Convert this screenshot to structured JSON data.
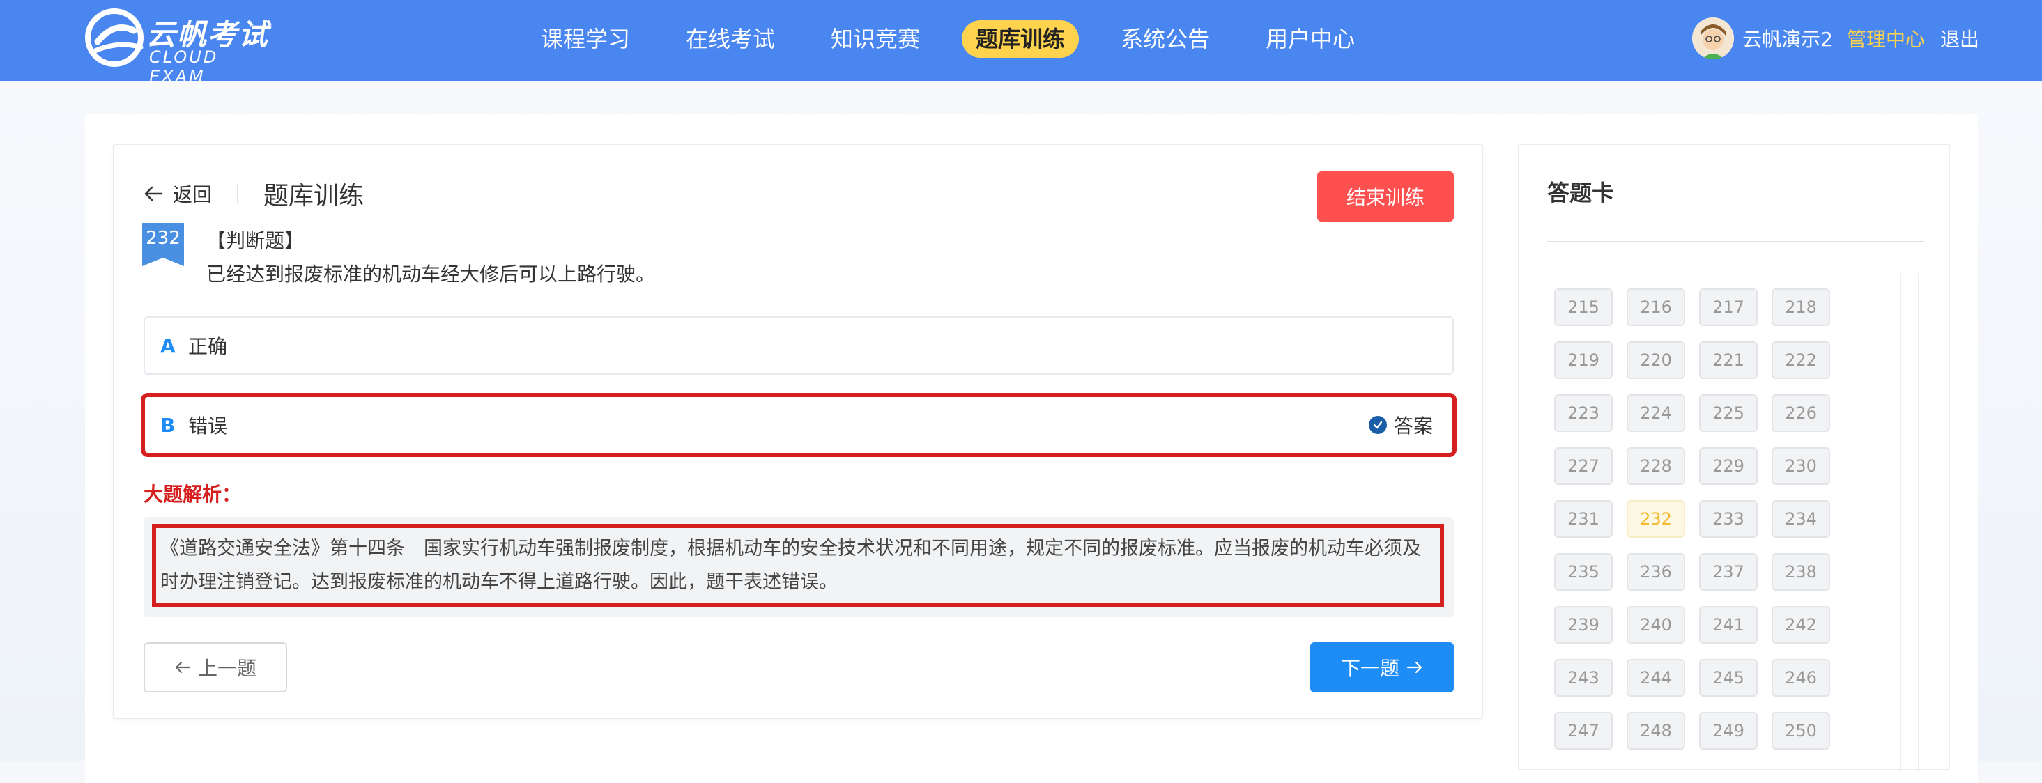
{
  "brand": {
    "name_cn": "云帆考试",
    "name_en": "CLOUD EXAM"
  },
  "nav": {
    "items": [
      {
        "label": "课程学习",
        "active": false
      },
      {
        "label": "在线考试",
        "active": false
      },
      {
        "label": "知识竞赛",
        "active": false
      },
      {
        "label": "题库训练",
        "active": true
      },
      {
        "label": "系统公告",
        "active": false
      },
      {
        "label": "用户中心",
        "active": false
      }
    ]
  },
  "user": {
    "name": "云帆演示2",
    "admin_label": "管理中心",
    "logout_label": "退出"
  },
  "header": {
    "back_label": "返回",
    "title": "题库训练",
    "end_button": "结束训练"
  },
  "question": {
    "number": "232",
    "type": "【判断题】",
    "text": "已经达到报废标准的机动车经大修后可以上路行驶。",
    "options": [
      {
        "letter": "A",
        "text": "正确"
      },
      {
        "letter": "B",
        "text": "错误",
        "answer_label": "答案"
      }
    ]
  },
  "analysis": {
    "label": "大题解析：",
    "text": "《道路交通安全法》第十四条　国家实行机动车强制报废制度，根据机动车的安全技术状况和不同用途，规定不同的报废标准。应当报废的机动车必须及时办理注销登记。达到报废标准的机动车不得上道路行驶。因此，题干表述错误。"
  },
  "footer_buttons": {
    "prev": "上一题",
    "next": "下一题"
  },
  "answer_card": {
    "title": "答题卡",
    "current": "232",
    "numbers": [
      "215",
      "216",
      "217",
      "218",
      "219",
      "220",
      "221",
      "222",
      "223",
      "224",
      "225",
      "226",
      "227",
      "228",
      "229",
      "230",
      "231",
      "232",
      "233",
      "234",
      "235",
      "236",
      "237",
      "238",
      "239",
      "240",
      "241",
      "242",
      "243",
      "244",
      "245",
      "246",
      "247",
      "248",
      "249",
      "250"
    ]
  },
  "colors": {
    "nav_bg": "#4a86f0",
    "nav_active": "#ffd34d",
    "primary": "#1e8cf5",
    "danger": "#ff5050",
    "highlight_border": "#d62020"
  }
}
